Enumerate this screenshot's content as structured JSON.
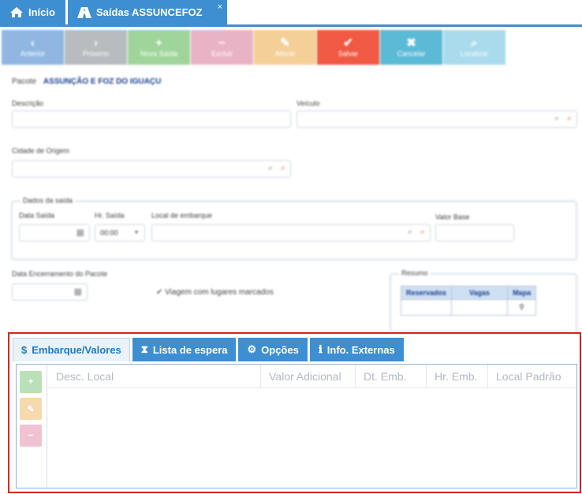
{
  "app_tabs": {
    "home_label": "Início",
    "doc_label": "Saídas ASSUNCEFOZ",
    "close_glyph": "×"
  },
  "toolbar": [
    {
      "name": "anterior-button",
      "label": "Anterior",
      "glyph": "‹",
      "color": "#8fb7e2"
    },
    {
      "name": "proximo-button",
      "label": "Próximo",
      "glyph": "›",
      "color": "#b8bcc0"
    },
    {
      "name": "nova-saida-button",
      "label": "Nova Saída",
      "glyph": "+",
      "color": "#9fd59a"
    },
    {
      "name": "excluir-button",
      "label": "Excluir",
      "glyph": "−",
      "color": "#e9b3c6"
    },
    {
      "name": "alterar-button",
      "label": "Alterar",
      "glyph": "✎",
      "color": "#f4cf98"
    },
    {
      "name": "salvar-button",
      "label": "Salvar",
      "glyph": "✔",
      "color": "#f05a45"
    },
    {
      "name": "cancelar-button",
      "label": "Cancelar",
      "glyph": "✖",
      "color": "#5bbad6"
    },
    {
      "name": "localizar-button",
      "label": "Localizar",
      "glyph": "⌕",
      "color": "#a9dbec"
    }
  ],
  "form": {
    "pacote_label": "Pacote",
    "pacote_value": "ASSUNÇÃO E FOZ DO IGUAÇU",
    "descricao_label": "Descrição",
    "veiculo_label": "Veículo",
    "cidade_origem_label": "Cidade de Origem",
    "dados_saida_legend": "Dados da saída",
    "data_saida_label": "Data Saída",
    "hr_saida_label": "Hr. Saída",
    "hr_saida_value": "00:00",
    "local_embarque_label": "Local de embarque",
    "valor_base_label": "Valor Base",
    "data_encerramento_label": "Data Encerramento do Pacote",
    "viagem_lugares_label": "Viagem com lugares marcados"
  },
  "resumo": {
    "legend": "Resumo",
    "columns": [
      "Reservados",
      "Vagas",
      "Mapa"
    ]
  },
  "panel": {
    "tabs": [
      {
        "name": "tab-embarque-valores",
        "label": "Embarque/Valores",
        "icon": "$",
        "active": true
      },
      {
        "name": "tab-lista-de-espera",
        "label": "Lista de espera",
        "icon": "⧗",
        "active": false
      },
      {
        "name": "tab-opcoes",
        "label": "Opções",
        "icon": "⚙",
        "active": false
      },
      {
        "name": "tab-info-externas",
        "label": "Info. Externas",
        "icon": "ℹ",
        "active": false
      }
    ],
    "side_buttons": [
      {
        "name": "add-row-button",
        "glyph": "+",
        "color": "#b9e0b7"
      },
      {
        "name": "edit-row-button",
        "glyph": "✎",
        "color": "#f7d9ad"
      },
      {
        "name": "remove-row-button",
        "glyph": "−",
        "color": "#f1c3d2"
      }
    ],
    "columns": [
      "Desc. Local",
      "Valor Adicional",
      "Dt. Emb.",
      "Hr. Emb.",
      "Local Padrão"
    ]
  }
}
